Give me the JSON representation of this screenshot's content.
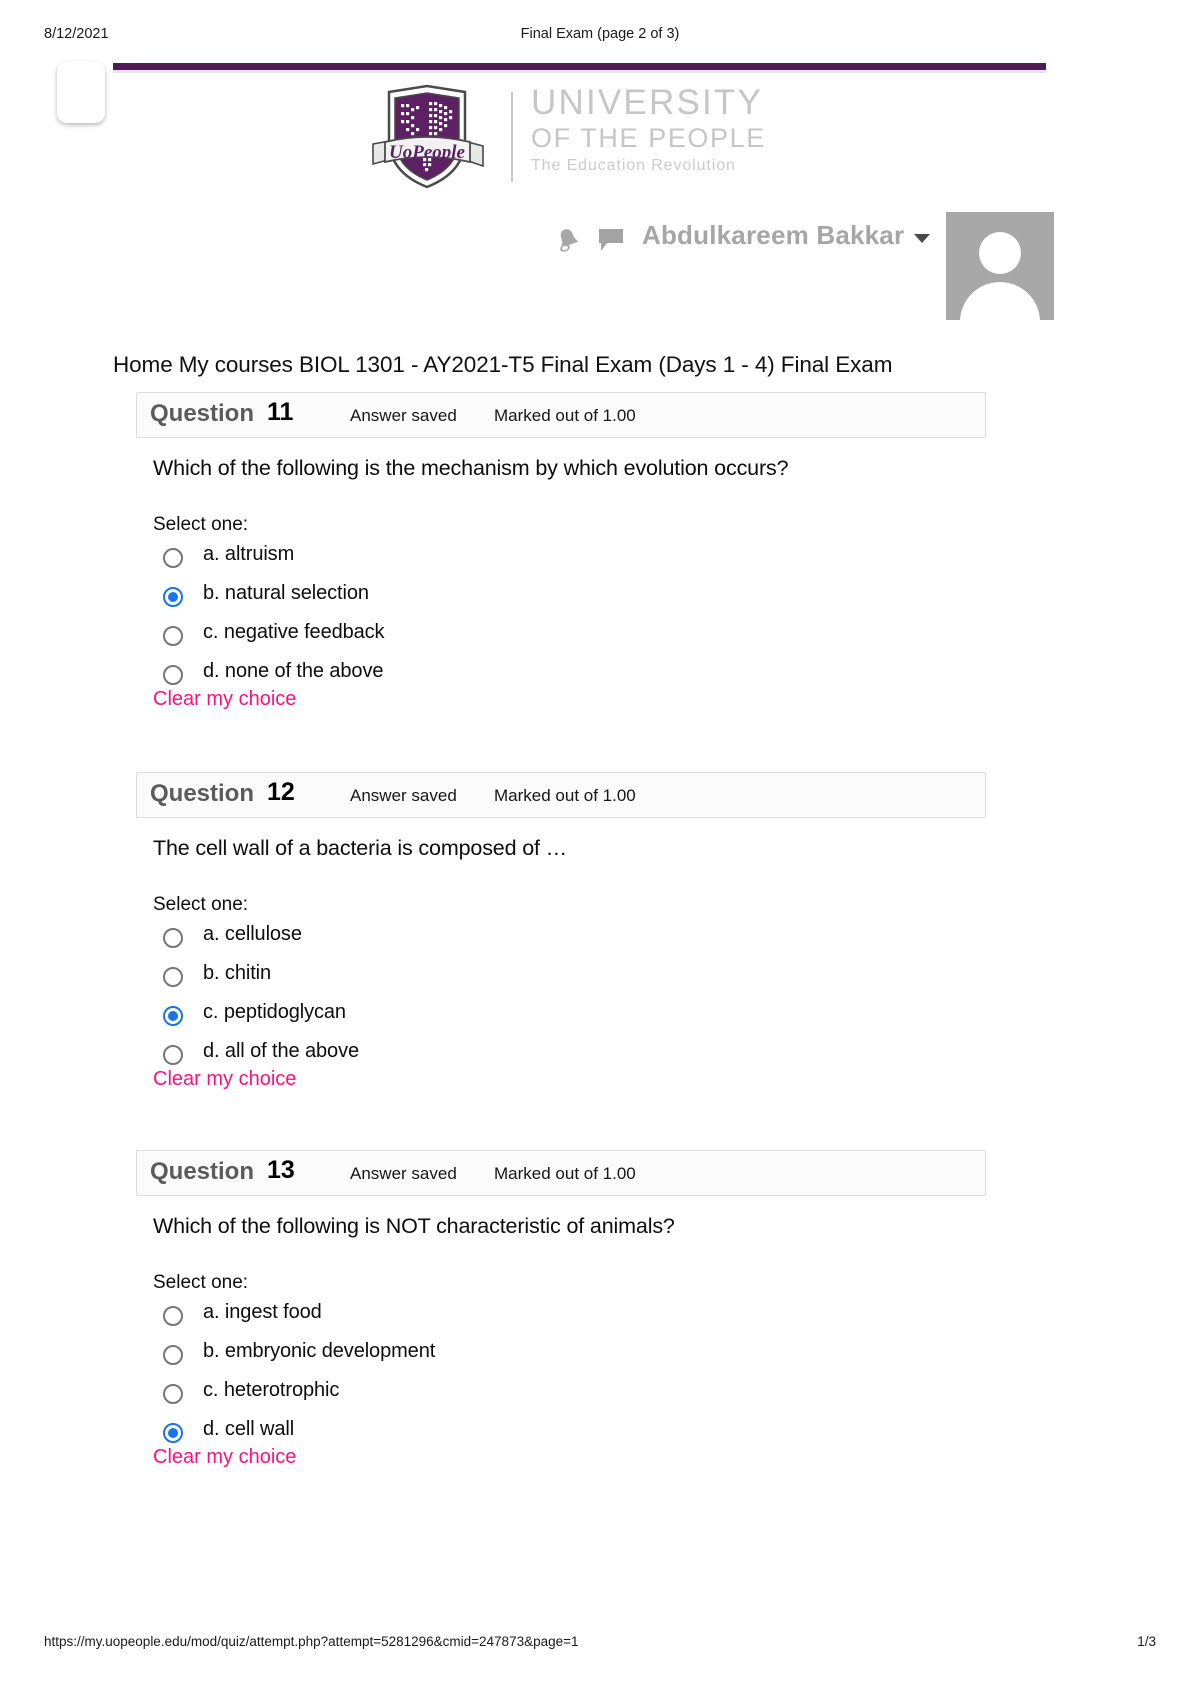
{
  "print_header": {
    "date": "8/12/2021",
    "title": "Final Exam (page 2 of 3)"
  },
  "brand": {
    "logo_icon": "uopeople-shield-logo",
    "banner_text": "UoPeople",
    "line1": "UNIVERSITY",
    "line2": "OF THE PEOPLE",
    "line3": "The Education Revolution",
    "accent_color": "#4f1a56"
  },
  "userbar": {
    "bell_icon": "notifications-bell-icon",
    "chat_icon": "messages-chat-icon",
    "user_name": "Abdulkareem Bakkar",
    "caret_icon": "chevron-down-icon",
    "avatar_icon": "user-avatar"
  },
  "breadcrumb": "Home My courses BIOL 1301 - AY2021-T5 Final Exam (Days 1 - 4) Final Exam",
  "labels": {
    "question_word": "Question",
    "select_one": "Select one:",
    "clear_choice": "Clear my choice",
    "clear_choice_color": "#ff107f",
    "selected_color": "#1a73e8"
  },
  "questions": [
    {
      "number": "11",
      "state": "Answer saved",
      "mark": "Marked out of 1.00",
      "text": "Which of the following is the mechanism by which evolution occurs?",
      "options": [
        {
          "label": "a. altruism",
          "selected": false
        },
        {
          "label": "b. natural selection",
          "selected": true
        },
        {
          "label": "c. negative feedback",
          "selected": false
        },
        {
          "label": "d. none of the above",
          "selected": false
        }
      ]
    },
    {
      "number": "12",
      "state": "Answer saved",
      "mark": "Marked out of 1.00",
      "text": "The cell wall of a bacteria is composed of …",
      "options": [
        {
          "label": "a. cellulose",
          "selected": false
        },
        {
          "label": "b. chitin",
          "selected": false
        },
        {
          "label": "c. peptidoglycan",
          "selected": true
        },
        {
          "label": "d. all of the above",
          "selected": false
        }
      ]
    },
    {
      "number": "13",
      "state": "Answer saved",
      "mark": "Marked out of 1.00",
      "text": "Which of the following is NOT characteristic of animals?",
      "options": [
        {
          "label": "a. ingest food",
          "selected": false
        },
        {
          "label": "b. embryonic development",
          "selected": false
        },
        {
          "label": "c. heterotrophic",
          "selected": false
        },
        {
          "label": "d. cell wall",
          "selected": true
        }
      ]
    }
  ],
  "print_footer": {
    "url": "https://my.uopeople.edu/mod/quiz/attempt.php?attempt=5281296&cmid=247873&page=1",
    "page": "1/3"
  }
}
